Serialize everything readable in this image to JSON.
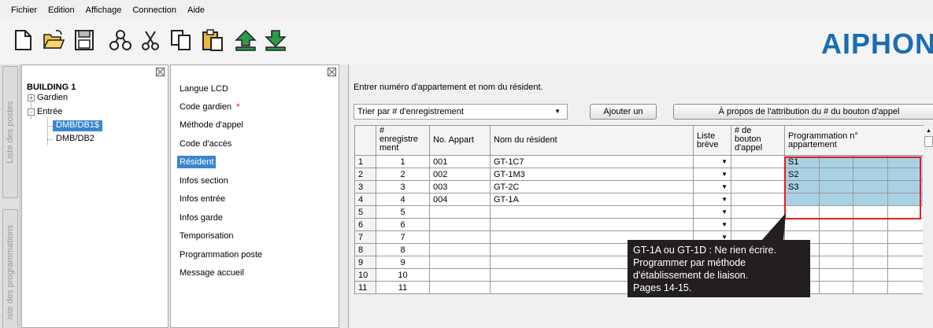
{
  "menubar": [
    "Fichier",
    "Edition",
    "Affichage",
    "Connection",
    "Aide"
  ],
  "toolbar": {
    "icons": [
      "new-file-icon",
      "open-folder-icon",
      "save-icon",
      "network-icon",
      "cut-icon",
      "copy-icon",
      "paste-icon",
      "upload-icon",
      "download-icon"
    ],
    "brand": "AIPHON"
  },
  "sidetabs": [
    "Liste des postes",
    "iste des programmations"
  ],
  "tree": {
    "root": "BUILDING 1",
    "nodes": [
      {
        "label": "Gardien",
        "sign": "+"
      },
      {
        "label": "Entrée",
        "sign": "-"
      }
    ],
    "leaves": [
      "DMB/DB1$",
      "DMB/DB2"
    ]
  },
  "settings_menu": {
    "items": [
      "Langue LCD",
      "Code gardien",
      "Méthode d'appel",
      "Code d'accès",
      "Résident",
      "Infos section",
      "Infos entrée",
      "Infos garde",
      "Temporisation",
      "Programmation poste",
      "Message accueil"
    ],
    "required_mark": "*",
    "selected": "Résident"
  },
  "main": {
    "instruction": "Entrer numéro d'appartement et nom du résident.",
    "sort_select": "Trier par # d'enregistrement",
    "add_button": "Ajouter un",
    "about_button": "À propos de l'attribution du # du bouton d'appel",
    "columns": [
      "#\nenregistre\nment",
      "No. Appart",
      "Nom du résident",
      "Liste\nbrève",
      "# de\nbouton\nd'appel",
      "Programmation n°\nappartement"
    ],
    "rows": [
      {
        "n": "1",
        "rec": "1",
        "apt": "001",
        "name": "GT-1C7",
        "prog": "S1"
      },
      {
        "n": "2",
        "rec": "2",
        "apt": "002",
        "name": "GT-1M3",
        "prog": "S2"
      },
      {
        "n": "3",
        "rec": "3",
        "apt": "003",
        "name": "GT-2C",
        "prog": "S3"
      },
      {
        "n": "4",
        "rec": "4",
        "apt": "004",
        "name": "GT-1A",
        "prog": ""
      },
      {
        "n": "5",
        "rec": "5",
        "apt": "",
        "name": "",
        "prog": ""
      },
      {
        "n": "6",
        "rec": "6",
        "apt": "",
        "name": "",
        "prog": ""
      },
      {
        "n": "7",
        "rec": "7",
        "apt": "",
        "name": "",
        "prog": ""
      },
      {
        "n": "8",
        "rec": "8",
        "apt": "",
        "name": "",
        "prog": ""
      },
      {
        "n": "9",
        "rec": "9",
        "apt": "",
        "name": "",
        "prog": ""
      },
      {
        "n": "10",
        "rec": "10",
        "apt": "",
        "name": "",
        "prog": ""
      },
      {
        "n": "11",
        "rec": "11",
        "apt": "",
        "name": "",
        "prog": ""
      }
    ]
  },
  "callout": {
    "lines": [
      "GT-1A ou GT-1D : Ne rien écrire.",
      "Programmer par méthode",
      "d'établissement de liaison.",
      "Pages 14-15."
    ]
  },
  "colors": {
    "selection": "#3a86cf",
    "brand": "#1b6db4",
    "program_cell": "#a9d1e4",
    "highlight_box": "#e02020",
    "callout_bg": "#231f20"
  }
}
